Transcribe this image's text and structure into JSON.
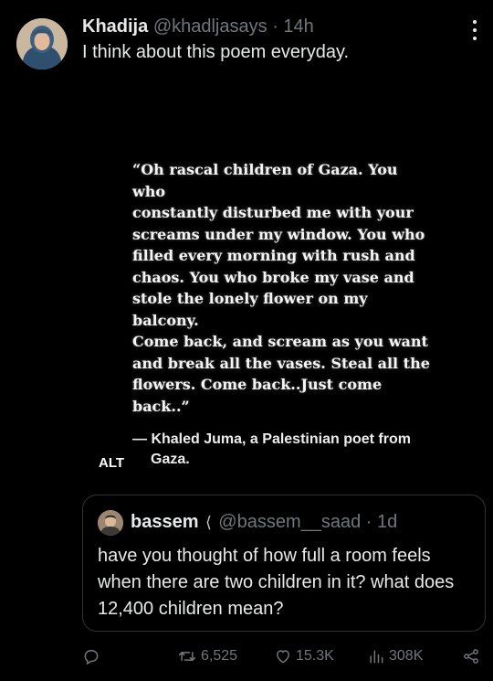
{
  "post": {
    "author_name": "Khadija",
    "author_handle": "@khadljasays",
    "separator": "·",
    "time": "14h",
    "text": "I think about this poem everyday."
  },
  "media": {
    "poem_lines": [
      "“Oh rascal children of Gaza. You who",
      "constantly disturbed me with your",
      "screams under my window. You who",
      "filled every morning with rush and",
      "chaos. You who broke my vase and",
      "stole the lonely flower on my balcony.",
      "Come back, and scream as you want",
      "and break all the vases. Steal all the",
      "flowers. Come back..Just come back..”"
    ],
    "attribution_line1": "— Khaled Juma, a Palestinian poet from",
    "attribution_line2": "Gaza.",
    "alt_label": "ALT"
  },
  "quoted": {
    "author_name": "bassem",
    "flag": "⟨",
    "author_handle": "@bassem__saad",
    "separator": "·",
    "time": "1d",
    "text": "have you thought of how full a room feels when there are two children in it? what does 12,400 children mean?"
  },
  "actions": {
    "replies": "",
    "reposts": "6,525",
    "likes": "15.3K",
    "views": "308K"
  },
  "icons": {
    "more": "more-vertical-icon",
    "reply": "reply-icon",
    "repost": "repost-icon",
    "like": "heart-icon",
    "views": "views-icon",
    "share": "share-icon"
  },
  "colors": {
    "background": "#000000",
    "text": "#e7e9ea",
    "secondary": "#71767b",
    "border": "#2f3336"
  }
}
